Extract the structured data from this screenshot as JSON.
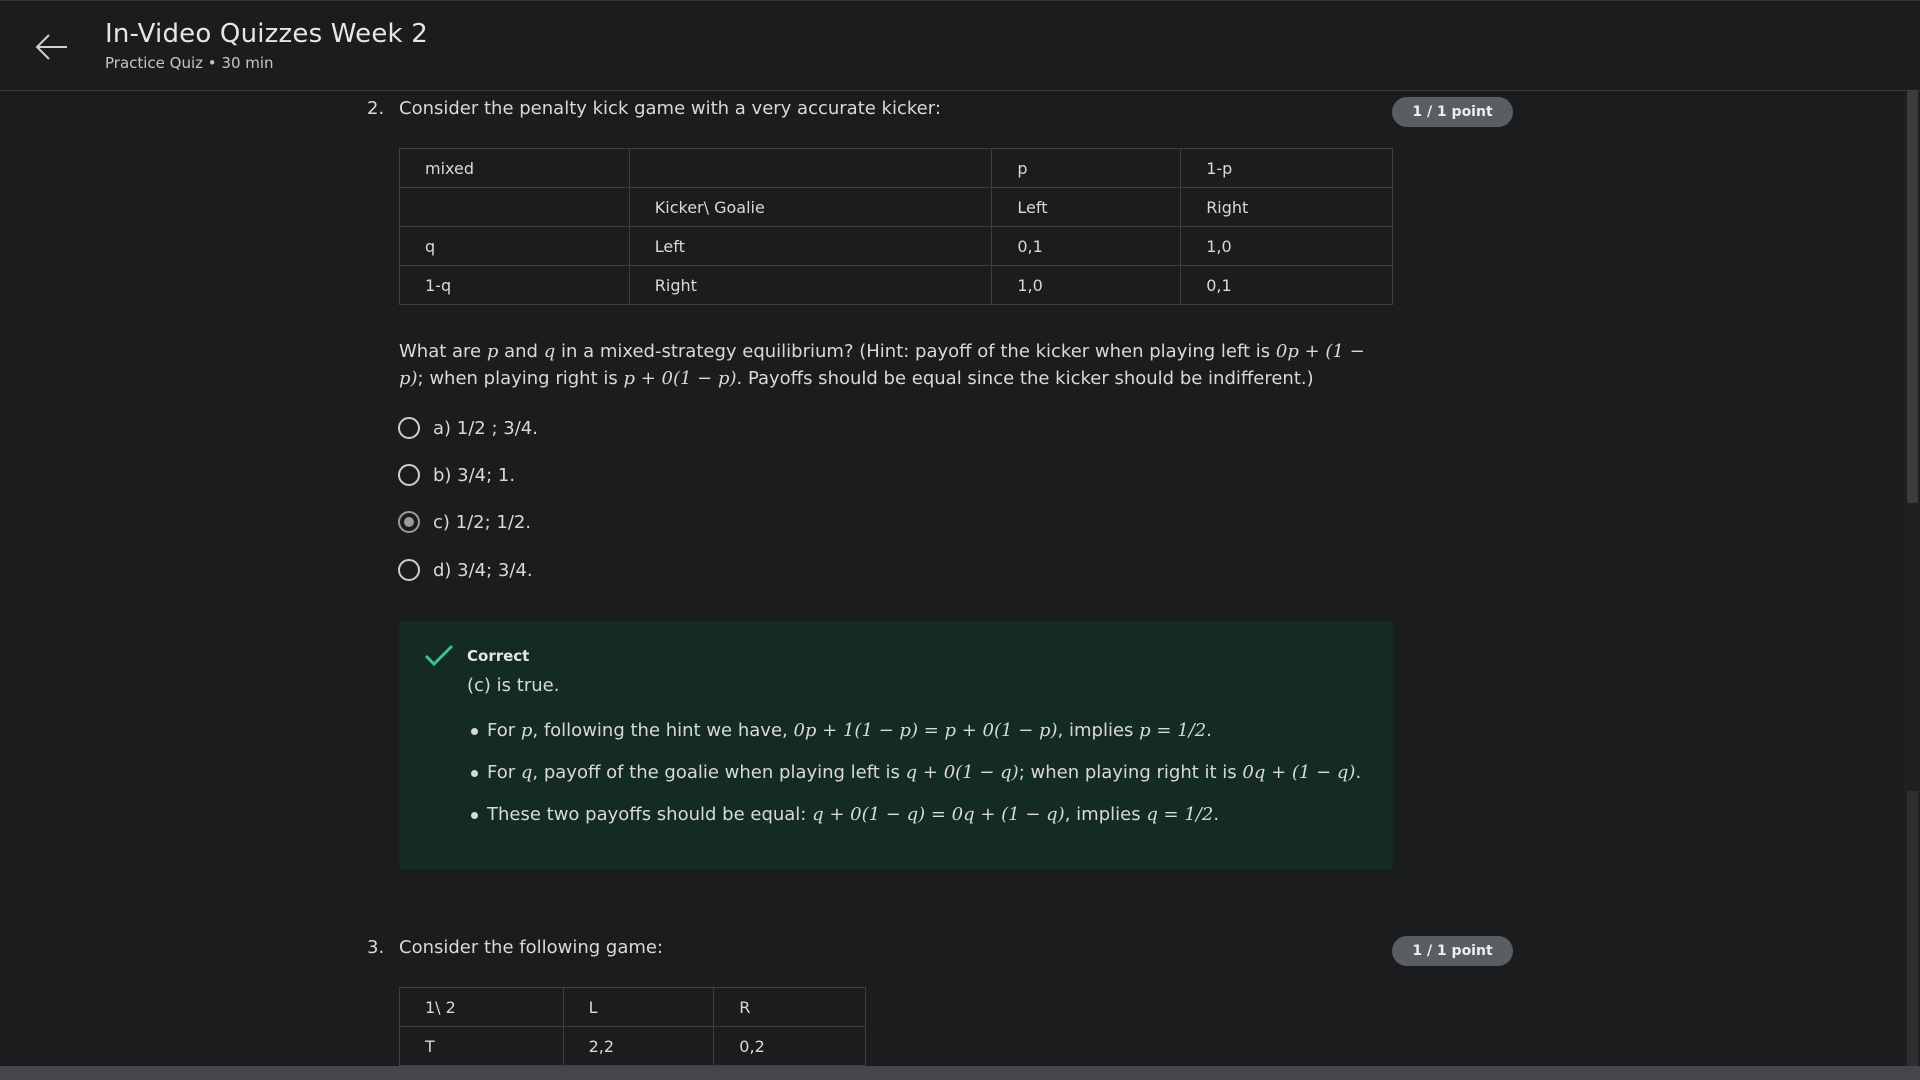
{
  "header": {
    "title": "In-Video Quizzes Week 2",
    "subtitle": "Practice Quiz • 30 min",
    "back_icon": "arrow-left-icon"
  },
  "question2": {
    "number": "2.",
    "prompt": "Consider the penalty kick game with a very accurate kicker:",
    "points": "1 / 1 point",
    "table": [
      [
        "mixed",
        "",
        "p",
        "1-p"
      ],
      [
        "",
        "Kicker\\ Goalie",
        "Left",
        "Right"
      ],
      [
        "q",
        "Left",
        "0,1",
        "1,0"
      ],
      [
        "1-q",
        "Right",
        "1,0",
        "0,1"
      ]
    ],
    "body": {
      "t1": "What are ",
      "m1": "p",
      "t2": " and ",
      "m2": "q",
      "t3": " in a mixed-strategy equilibrium? (Hint: payoff of the kicker when playing left is ",
      "m3": "0p + (1 − p)",
      "t4": "; when playing right is ",
      "m4": "p + 0(1 − p)",
      "t5": ". Payoffs should be equal since the kicker should be indifferent.)"
    },
    "options": [
      "a) 1/2 ; 3/4.",
      "b) 3/4; 1.",
      "c) 1/2; 1/2.",
      "d) 3/4; 3/4."
    ],
    "selected_index": 2,
    "feedback": {
      "title": "Correct",
      "summary": "(c) is true.",
      "b1": {
        "t1": "For ",
        "m1": "p",
        "t2": ", following the hint we have, ",
        "m2": "0p + 1(1 − p) = p + 0(1 − p)",
        "t3": ", implies ",
        "m3": "p = 1/2",
        "t4": "."
      },
      "b2": {
        "t1": "For ",
        "m1": "q",
        "t2": ", payoff of the goalie when playing left is ",
        "m2": "q + 0(1 − q)",
        "t3": "; when playing right it is ",
        "m3": "0q + (1 − q)",
        "t4": "."
      },
      "b3": {
        "t1": "These two payoffs should be equal: ",
        "m1": "q + 0(1 − q) = 0q + (1 − q)",
        "t2": ", implies ",
        "m2": "q = 1/2",
        "t3": "."
      }
    }
  },
  "question3": {
    "number": "3.",
    "prompt": "Consider the following game:",
    "points": "1 / 1 point",
    "table": [
      [
        "1\\ 2",
        "L",
        "R"
      ],
      [
        "T",
        "2,2",
        "0,2"
      ]
    ]
  },
  "colors": {
    "background": "#1b1c1e",
    "feedback_bg": "#142b23",
    "check": "#3ec48a",
    "badge": "#5a5d61"
  }
}
